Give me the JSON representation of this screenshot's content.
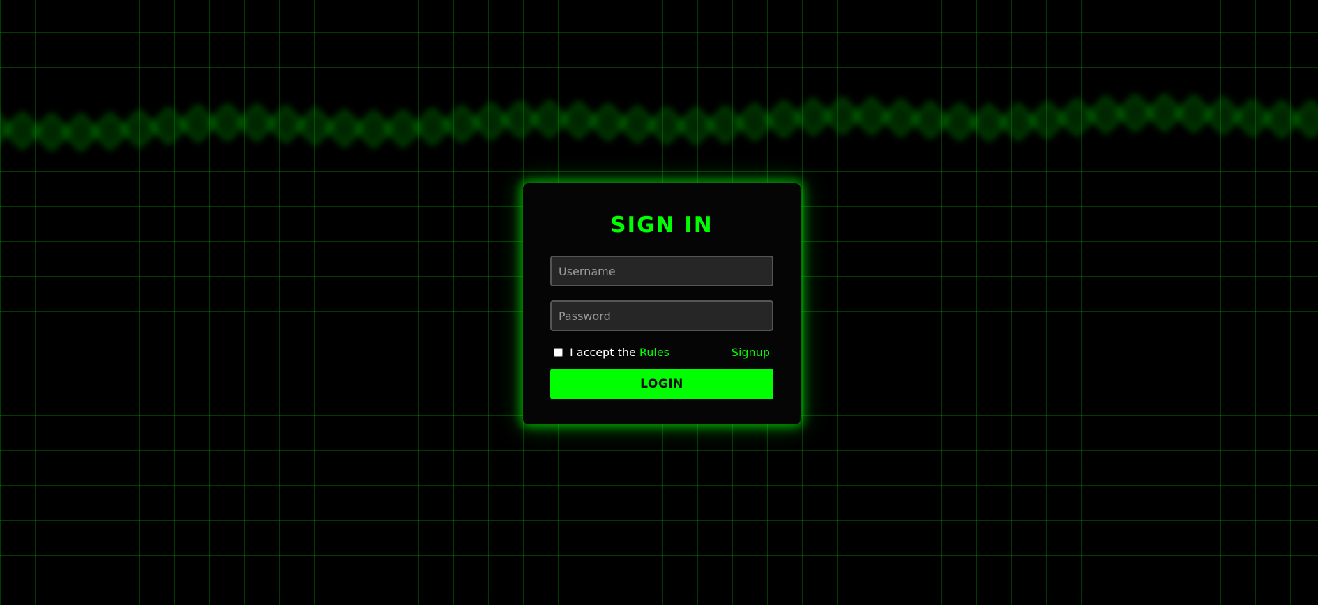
{
  "signin": {
    "title": "SIGN IN",
    "username_placeholder": "Username",
    "password_placeholder": "Password",
    "username_value": "",
    "password_value": "",
    "accept_prefix": "I accept the",
    "rules_link": "Rules",
    "signup_link": "Signup",
    "login_button": "LOGIN",
    "accept_checked": false
  },
  "colors": {
    "accent": "#00ff00",
    "background": "#000000",
    "grid": "#00aa00",
    "input_bg": "#262626"
  }
}
